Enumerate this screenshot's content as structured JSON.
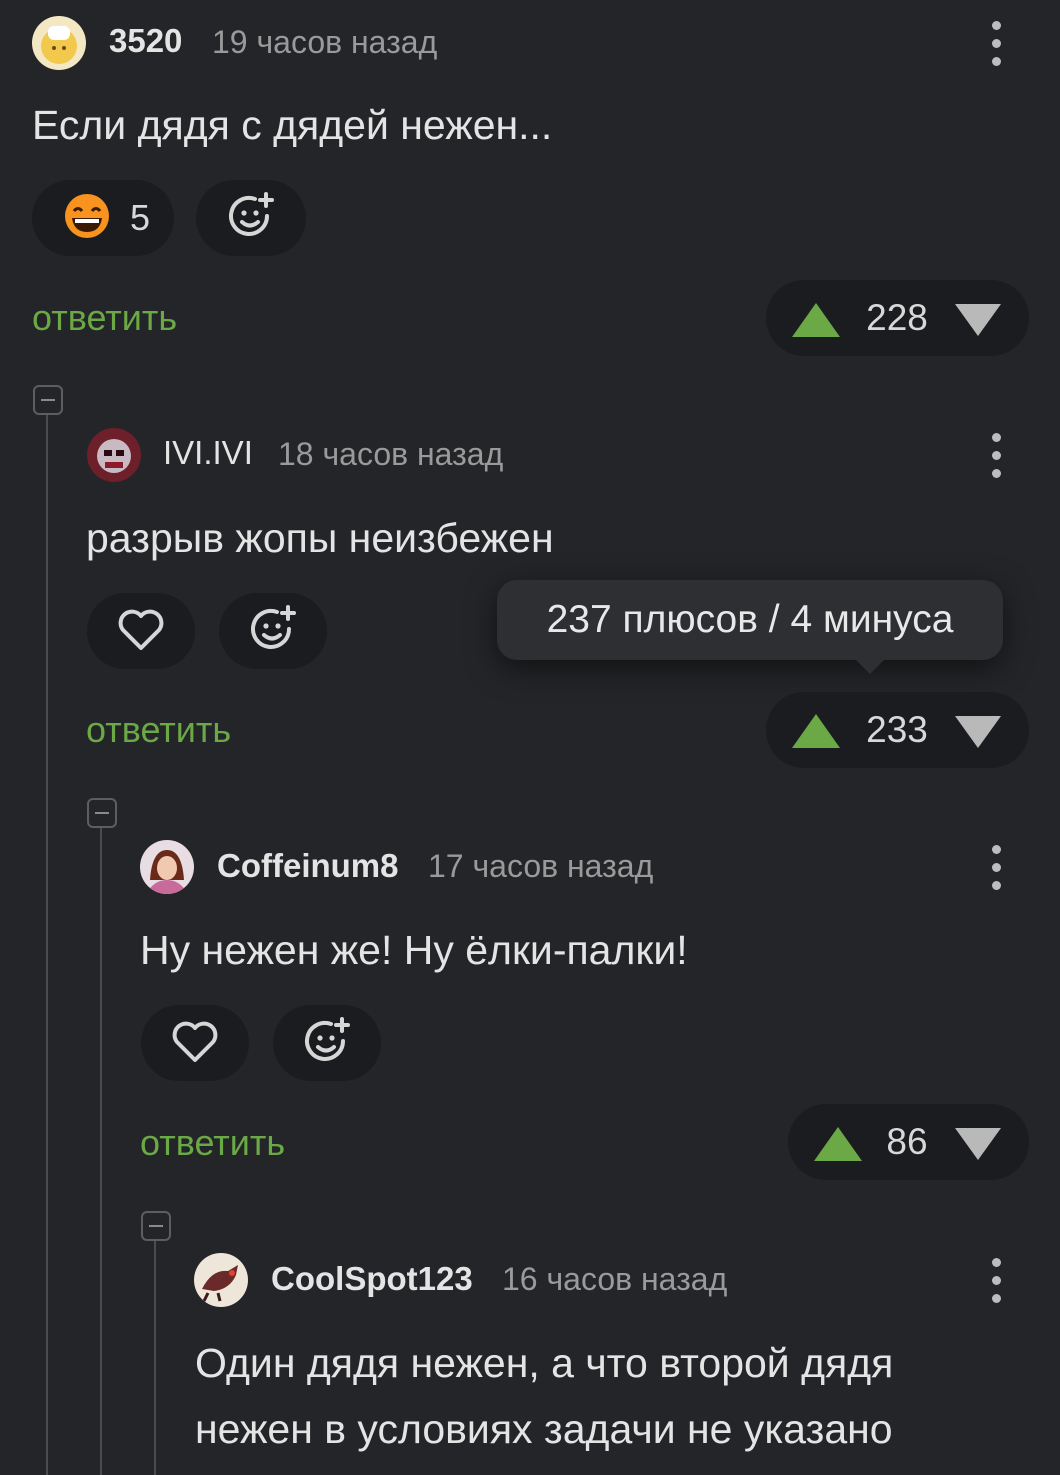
{
  "comments": [
    {
      "username": "3520",
      "time": "19 часов назад",
      "text": "Если дядя с дядей нежен...",
      "reaction_count": "5",
      "reply": "ответить",
      "rating": "228"
    },
    {
      "username": "IVI.IVI",
      "time": "18 часов назад",
      "text": "разрыв жопы неизбежен",
      "reply": "ответить",
      "rating": "233",
      "tooltip": "237 плюсов / 4 минуса"
    },
    {
      "username": "Coffeinum8",
      "time": "17 часов назад",
      "text": "Ну нежен же! Ну ёлки-палки!",
      "reply": "ответить",
      "rating": "86"
    },
    {
      "username": "CoolSpot123",
      "time": "16 часов назад",
      "text_line1": "Один дядя нежен, а что второй дядя",
      "text_line2": "нежен в условиях задачи не указано"
    }
  ],
  "colors": {
    "background": "#232528",
    "accent_green": "#6ba846",
    "pill_bg": "#1b1c1f"
  },
  "icons": [
    "avatar",
    "more-vertical-icon",
    "grinning-emoji-icon",
    "add-reaction-icon",
    "heart-icon",
    "upvote-icon",
    "downvote-icon",
    "collapse-icon"
  ]
}
